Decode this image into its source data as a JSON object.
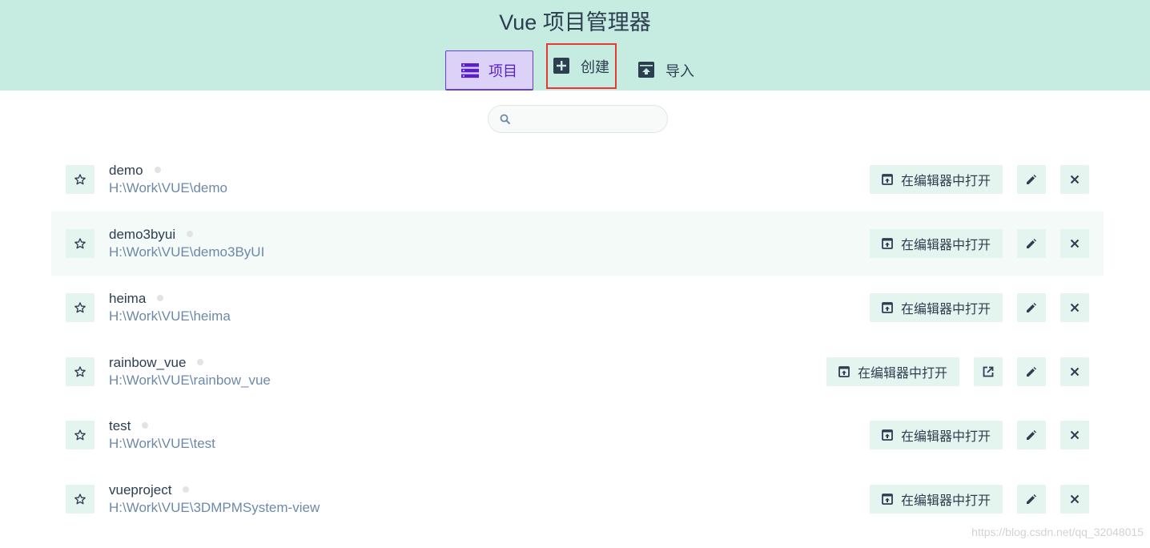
{
  "header": {
    "title": "Vue 项目管理器",
    "tabs": [
      {
        "label": "项目",
        "icon": "list-icon",
        "active": true
      },
      {
        "label": "创建",
        "icon": "add-box-icon",
        "highlighted": true
      },
      {
        "label": "导入",
        "icon": "unarchive-icon"
      }
    ]
  },
  "search": {
    "placeholder": "",
    "value": ""
  },
  "projects": [
    {
      "name": "demo",
      "path": "H:\\Work\\VUE\\demo",
      "open_label": "在编辑器中打开",
      "has_external": false
    },
    {
      "name": "demo3byui",
      "path": "H:\\Work\\VUE\\demo3ByUI",
      "open_label": "在编辑器中打开",
      "has_external": false
    },
    {
      "name": "heima",
      "path": "H:\\Work\\VUE\\heima",
      "open_label": "在编辑器中打开",
      "has_external": false
    },
    {
      "name": "rainbow_vue",
      "path": "H:\\Work\\VUE\\rainbow_vue",
      "open_label": "在编辑器中打开",
      "has_external": true
    },
    {
      "name": "test",
      "path": "H:\\Work\\VUE\\test",
      "open_label": "在编辑器中打开",
      "has_external": false
    },
    {
      "name": "vueproject",
      "path": "H:\\Work\\VUE\\3DMPMSystem-view",
      "open_label": "在编辑器中打开",
      "has_external": false
    }
  ],
  "watermark": "https://blog.csdn.net/qq_32048015",
  "colors": {
    "header_bg": "#c6ebe0",
    "active_tab": "#6b3fd6",
    "highlight_border": "#e53935",
    "button_bg": "#e4f4ee",
    "path_text": "#6d89a8"
  }
}
